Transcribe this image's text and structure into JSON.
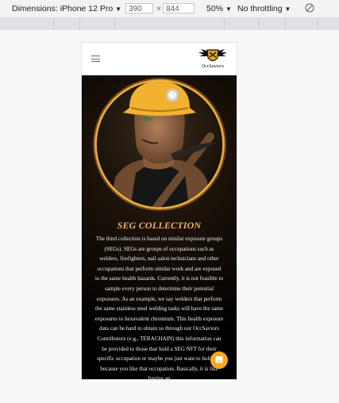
{
  "devtools": {
    "dimensions_label": "Dimensions: iPhone 12 Pro",
    "width": "390",
    "times": "×",
    "height": "844",
    "zoom": "50%",
    "throttling": "No throttling"
  },
  "site": {
    "logo_text": "OccSaviors"
  },
  "colors": {
    "accent": "#f2b565",
    "chat": "#f5a81c",
    "helmet": "#f2b230"
  },
  "section": {
    "title": "SEG COLLECTION",
    "body": "The third collection is based on similar exposure groups (SEGs). SEGs are groups of occupations such as welders, firefighters, nail salon technicians and other occupations that perform similar work and are exposed to the same health hazards. Currently, it is not feasible to sample every person to determine their potential exposures. As an example, we say welders that perform the same stainless steel welding tasks will have the same exposures to hexavalent chromium. This health exposure data can be hard to obtain so through our OccSaviors Contributors (e.g., TERACHAIN) this information can be provided to those that hold a SEG NFT for their specific occupation or maybe you just want to hold one because you like that occupation. Basically, it is like having an"
  }
}
